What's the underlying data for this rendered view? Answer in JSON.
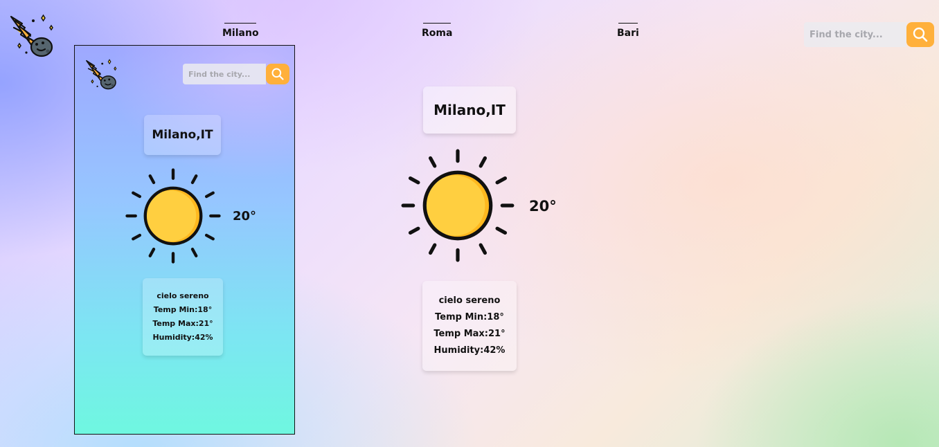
{
  "header": {
    "logo_icon": "meteor-icon",
    "tabs": [
      {
        "label": "Milano"
      },
      {
        "label": "Roma"
      },
      {
        "label": "Bari"
      }
    ],
    "search": {
      "placeholder": "Find the city...",
      "button_icon": "search-icon"
    }
  },
  "mobile_preview": {
    "logo_icon": "meteor-icon",
    "search": {
      "placeholder": "Find the city...",
      "button_icon": "search-icon"
    },
    "city": "Milano,IT",
    "weather_icon": "sun-icon",
    "temperature": "20°",
    "description": "cielo sereno",
    "temp_min": "Temp Min:18°",
    "temp_max": "Temp Max:21°",
    "humidity": "Humidity:42%"
  },
  "main": {
    "city": "Milano,IT",
    "weather_icon": "sun-icon",
    "temperature": "20°",
    "description": "cielo sereno",
    "temp_min": "Temp Min:18°",
    "temp_max": "Temp Max:21°",
    "humidity": "Humidity:42%"
  },
  "colors": {
    "accent": "#ffb03b",
    "sun_fill": "#ffcf40",
    "sun_shade": "#ffb81f",
    "outline": "#111111"
  }
}
